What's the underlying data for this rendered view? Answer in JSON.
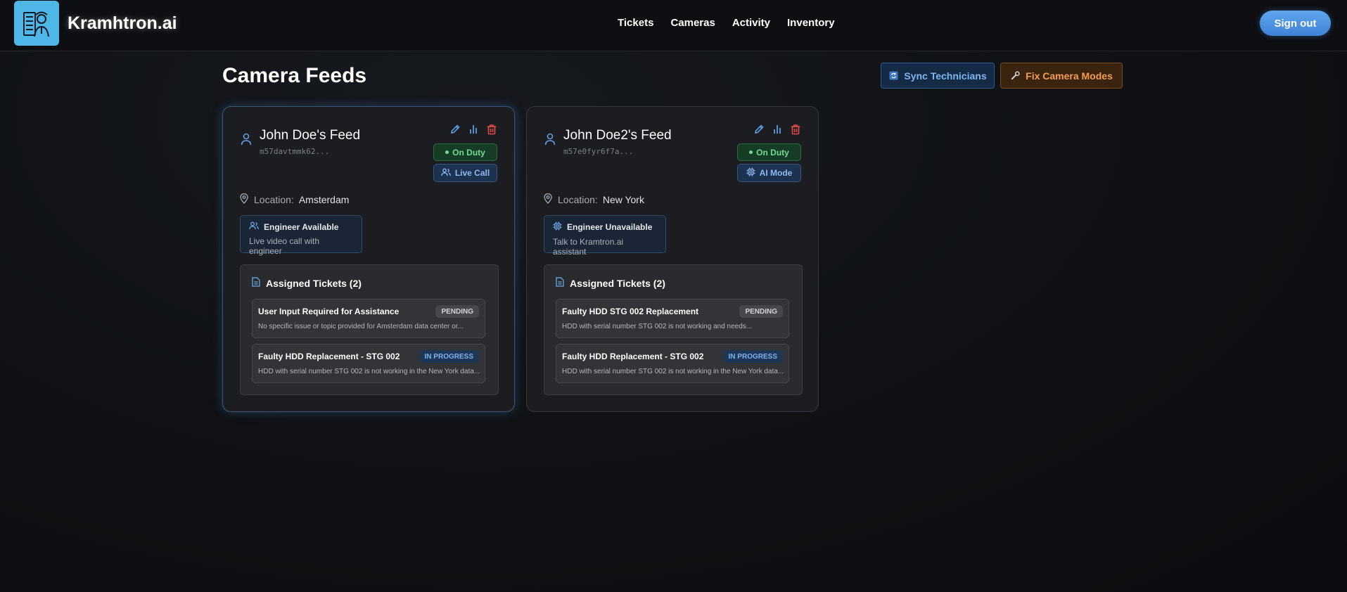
{
  "app": {
    "brand": "Kramhtron.ai",
    "nav": [
      "Tickets",
      "Cameras",
      "Activity",
      "Inventory"
    ],
    "sign_out": "Sign out"
  },
  "page": {
    "title": "Camera Feeds",
    "sync_button": "Sync Technicians",
    "fix_button": "Fix Camera Modes"
  },
  "cards": [
    {
      "name": "John Doe's Feed",
      "id": "m57davtmmk62...",
      "duty": "On Duty",
      "mode": "Live Call",
      "location_label": "Location:",
      "location": "Amsterdam",
      "engineer_title": "Engineer Available",
      "engineer_sub": "Live video call with engineer",
      "tickets_heading": "Assigned Tickets (2)",
      "tickets": [
        {
          "title": "User Input Required for Assistance",
          "status": "PENDING",
          "desc": "No specific issue or topic provided for Amsterdam data center or..."
        },
        {
          "title": "Faulty HDD Replacement - STG 002",
          "status": "IN PROGRESS",
          "desc": "HDD with serial number STG 002 is not working in the New York data..."
        }
      ]
    },
    {
      "name": "John Doe2's Feed",
      "id": "m57e0fyr6f7a...",
      "duty": "On Duty",
      "mode": "AI Mode",
      "location_label": "Location:",
      "location": "New York",
      "engineer_title": "Engineer Unavailable",
      "engineer_sub": "Talk to Kramtron.ai assistant",
      "tickets_heading": "Assigned Tickets (2)",
      "tickets": [
        {
          "title": "Faulty HDD STG 002 Replacement",
          "status": "PENDING",
          "desc": "HDD with serial number STG 002 is not working and needs..."
        },
        {
          "title": "Faulty HDD Replacement - STG 002",
          "status": "IN PROGRESS",
          "desc": "HDD with serial number STG 002 is not working in the New York data..."
        }
      ]
    }
  ]
}
